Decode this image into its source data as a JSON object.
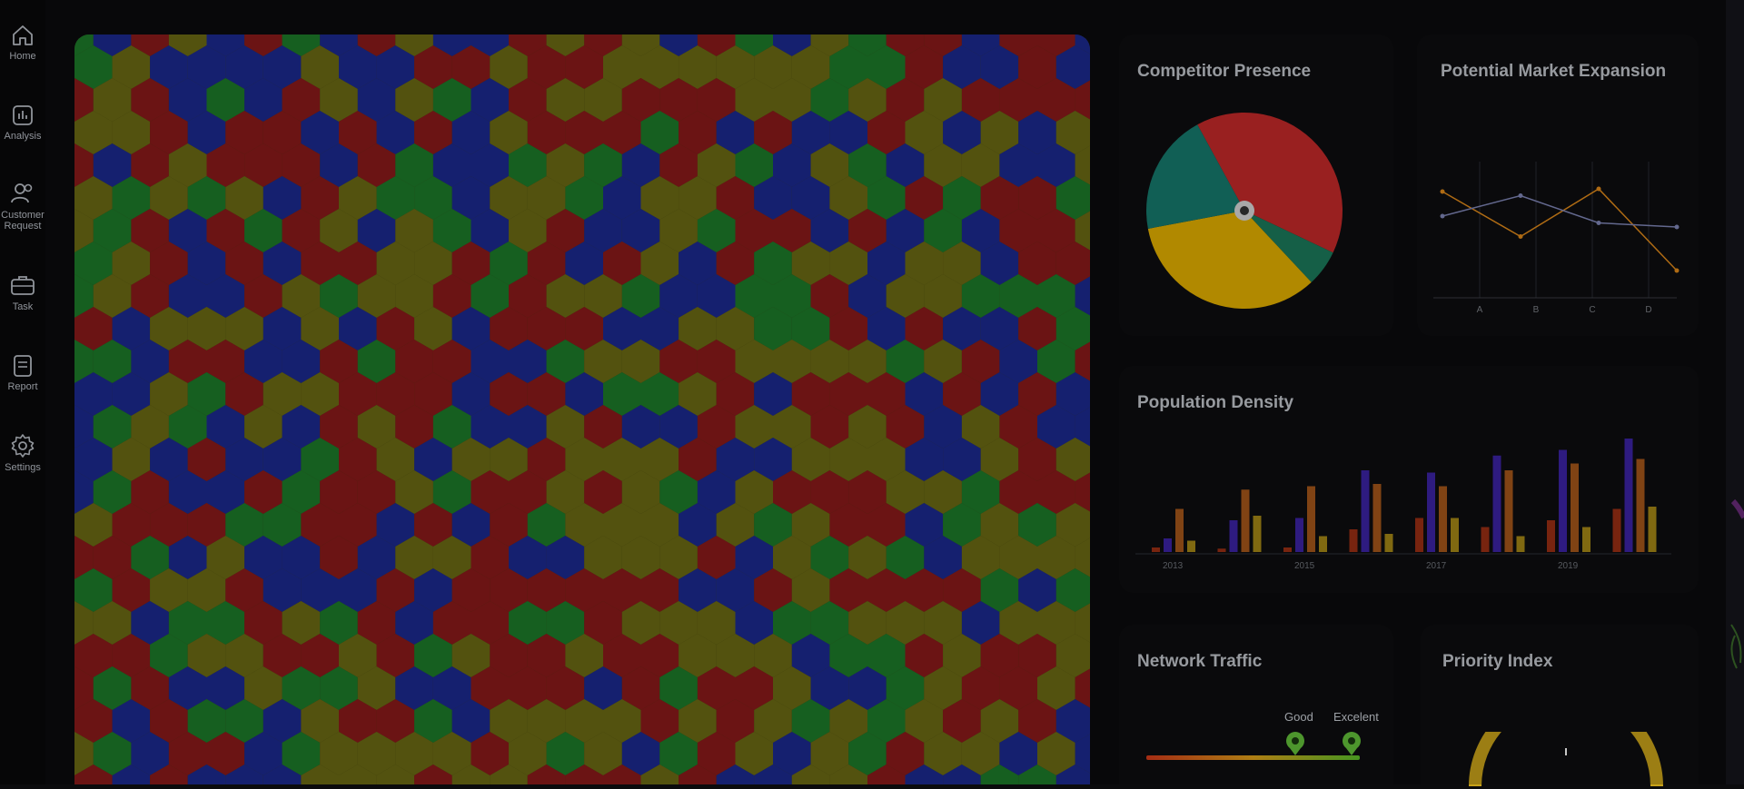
{
  "sidebar": {
    "items": [
      {
        "label": "Home",
        "icon": "home-icon"
      },
      {
        "label": "Analysis",
        "icon": "analysis-icon"
      },
      {
        "label": "Customer Request",
        "icon": "customer-request-icon"
      },
      {
        "label": "Task",
        "icon": "task-icon"
      },
      {
        "label": "Report",
        "icon": "report-icon"
      },
      {
        "label": "Settings",
        "icon": "settings-icon"
      }
    ]
  },
  "map": {
    "legend_colors": [
      "#8a1a1a",
      "#1c2a8f",
      "#1d7a2a",
      "#6b6a14"
    ]
  },
  "cards": {
    "competitor": {
      "title": "Competitor Presence"
    },
    "market": {
      "title": "Potential Market Expansion"
    },
    "population": {
      "title": "Population Density"
    },
    "network": {
      "title": "Network Traffic",
      "label_good": "Good",
      "label_excellent": "Excelent"
    },
    "priority": {
      "title": "Priority Index"
    }
  },
  "chart_data": [
    {
      "type": "pie",
      "title": "Competitor Presence",
      "slices": [
        {
          "value": 40,
          "color": "#c42a2a"
        },
        {
          "value": 6,
          "color": "#1b7a5b"
        },
        {
          "value": 34,
          "color": "#e3b000"
        },
        {
          "value": 20,
          "color": "#177a6e"
        }
      ]
    },
    {
      "type": "line",
      "title": "Potential Market Expansion",
      "categories": [
        "A",
        "B",
        "C",
        "D"
      ],
      "series": [
        {
          "color": "#e08a1a",
          "values": [
            0.78,
            0.45,
            0.8,
            0.2
          ]
        },
        {
          "color": "#7f86b7",
          "values": [
            0.6,
            0.75,
            0.55,
            0.52
          ]
        }
      ],
      "ylim": [
        0,
        1
      ]
    },
    {
      "type": "bar",
      "title": "Population Density",
      "tick_labels": [
        "2013",
        "2015",
        "2017",
        "2019"
      ],
      "series_colors": [
        "#c93b16",
        "#4b2bd6",
        "#d8701e",
        "#d8b01a"
      ],
      "groups": [
        [
          0.04,
          0.12,
          0.38,
          0.1
        ],
        [
          0.03,
          0.28,
          0.55,
          0.32
        ],
        [
          0.04,
          0.3,
          0.58,
          0.14
        ],
        [
          0.2,
          0.72,
          0.6,
          0.16
        ],
        [
          0.3,
          0.7,
          0.58,
          0.3
        ],
        [
          0.22,
          0.85,
          0.72,
          0.14
        ],
        [
          0.28,
          0.9,
          0.78,
          0.22
        ],
        [
          0.38,
          1.0,
          0.82,
          0.4
        ]
      ],
      "ylim": [
        0,
        1
      ]
    }
  ]
}
